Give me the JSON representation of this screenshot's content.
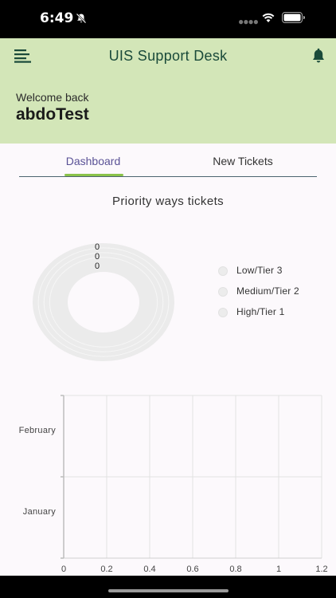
{
  "status_bar": {
    "time": "6:49"
  },
  "header": {
    "title": "UIS Support Desk"
  },
  "welcome": {
    "label": "Welcome back",
    "username": "abdoTest"
  },
  "tabs": [
    {
      "label": "Dashboard",
      "selected": true
    },
    {
      "label": "New Tickets",
      "selected": false
    }
  ],
  "colors": {
    "header_bg": "#d3e6b8",
    "tab_active": "#5a5296",
    "tab_indicator": "#8bc34a",
    "title": "#1a4a3a"
  },
  "chart_data": [
    {
      "type": "pie",
      "variant": "donut",
      "title": "Priority ways tickets",
      "categories": [
        "Low/Tier 3",
        "Medium/Tier 2",
        "High/Tier 1"
      ],
      "values": [
        0,
        0,
        0
      ],
      "legend": "right"
    },
    {
      "type": "bar",
      "orientation": "horizontal",
      "categories": [
        "February",
        "January"
      ],
      "values": [
        0,
        0
      ],
      "xlim": [
        0,
        1.2
      ],
      "xticks": [
        "0",
        "0.2",
        "0.4",
        "0.6",
        "0.8",
        "1",
        "1.2"
      ],
      "grid": true
    }
  ]
}
